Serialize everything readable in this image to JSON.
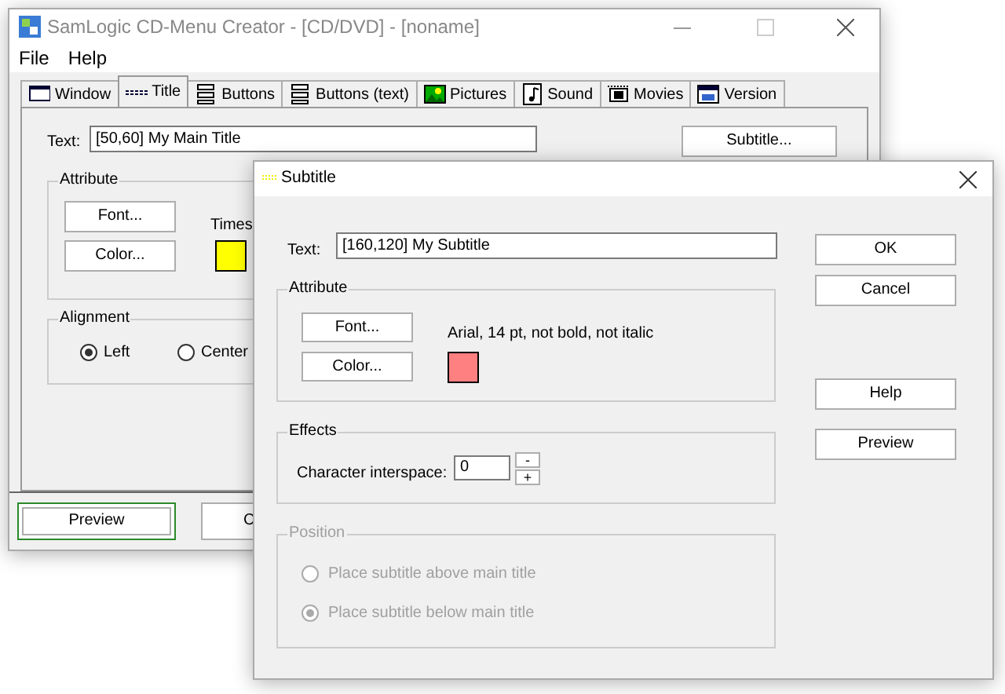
{
  "main_window": {
    "title": "SamLogic CD-Menu Creator - [CD/DVD] - [noname]",
    "menu": [
      "File",
      "Help"
    ],
    "tabs": [
      {
        "label": "Window",
        "selected": false
      },
      {
        "label": "Title",
        "selected": true
      },
      {
        "label": "Buttons",
        "selected": false
      },
      {
        "label": "Buttons (text)",
        "selected": false
      },
      {
        "label": "Pictures",
        "selected": false
      },
      {
        "label": "Sound",
        "selected": false
      },
      {
        "label": "Movies",
        "selected": false
      },
      {
        "label": "Version",
        "selected": false
      }
    ],
    "text_label": "Text:",
    "text_value": "[50,60] My Main Title",
    "subtitle_button": "Subtitle...",
    "attribute": {
      "legend": "Attribute",
      "font_button": "Font...",
      "color_button": "Color...",
      "font_description": "Times",
      "color": "#ffff00"
    },
    "alignment": {
      "legend": "Alignment",
      "options": [
        {
          "label": "Left",
          "selected": true
        },
        {
          "label": "Center",
          "selected": false
        }
      ]
    },
    "buttons": [
      {
        "label": "Preview",
        "default": true
      },
      {
        "label": "C",
        "default": false
      }
    ]
  },
  "dialog": {
    "title": "Subtitle",
    "text_label": "Text:",
    "text_value": "[160,120] My Subtitle",
    "attribute": {
      "legend": "Attribute",
      "font_button": "Font...",
      "color_button": "Color...",
      "font_description": "Arial, 14 pt, not bold, not italic",
      "color": "#ff8080"
    },
    "effects": {
      "legend": "Effects",
      "label": "Character interspace:",
      "value": "0",
      "decrement": "-",
      "increment": "+"
    },
    "position": {
      "legend": "Position",
      "disabled": true,
      "options": [
        {
          "label": "Place subtitle above main title",
          "selected": false
        },
        {
          "label": "Place subtitle below main title",
          "selected": true
        }
      ]
    },
    "buttons": [
      "OK",
      "Cancel",
      "Help",
      "Preview"
    ]
  }
}
